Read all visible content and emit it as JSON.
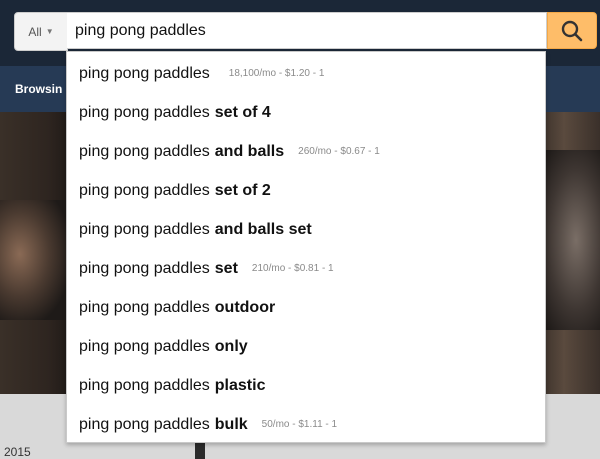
{
  "header": {
    "navbar_label": "Browsin",
    "year_text": "2015"
  },
  "search": {
    "scope_label": "All",
    "query": "ping pong paddles"
  },
  "suggestions": [
    {
      "prefix": "ping pong paddles",
      "suffix": "",
      "meta": "18,100/mo - $1.20 - 1"
    },
    {
      "prefix": "ping pong paddles",
      "suffix": "set of 4",
      "meta": ""
    },
    {
      "prefix": "ping pong paddles",
      "suffix": "and balls",
      "meta": "260/mo - $0.67 - 1"
    },
    {
      "prefix": "ping pong paddles",
      "suffix": "set of 2",
      "meta": ""
    },
    {
      "prefix": "ping pong paddles",
      "suffix": "and balls set",
      "meta": ""
    },
    {
      "prefix": "ping pong paddles",
      "suffix": "set",
      "meta": "210/mo - $0.81 - 1"
    },
    {
      "prefix": "ping pong paddles",
      "suffix": "outdoor",
      "meta": ""
    },
    {
      "prefix": "ping pong paddles",
      "suffix": "only",
      "meta": ""
    },
    {
      "prefix": "ping pong paddles",
      "suffix": "plastic",
      "meta": ""
    },
    {
      "prefix": "ping pong paddles",
      "suffix": "bulk",
      "meta": "50/mo - $1.11 - 1"
    }
  ],
  "icons": {
    "search_button": "search-icon",
    "scope_caret": "chevron-down-icon"
  },
  "colors": {
    "search_button_bg": "#febd69",
    "nav_bg": "#263a55"
  }
}
